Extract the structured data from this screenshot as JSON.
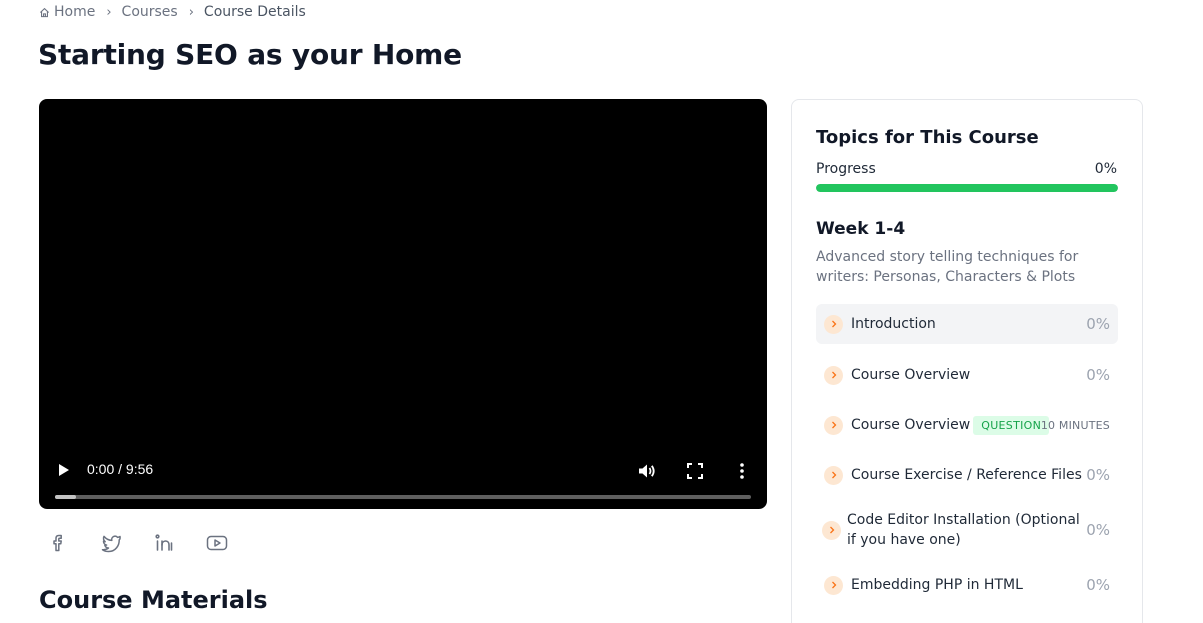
{
  "breadcrumb": {
    "home": "Home",
    "courses": "Courses",
    "current": "Course Details",
    "separator": "›"
  },
  "page": {
    "title": "Starting SEO as your Home"
  },
  "video": {
    "time": "0:00 / 9:56",
    "played_fraction": 0.03
  },
  "social": {
    "icons": [
      "facebook-icon",
      "twitter-icon",
      "linkedin-icon",
      "youtube-icon"
    ]
  },
  "materials": {
    "title": "Course Materials"
  },
  "sidebar": {
    "title": "Topics for This Course",
    "progress_label": "Progress",
    "progress_value": "0%",
    "progress_fraction": 1.0,
    "week": {
      "title": "Week 1-4",
      "description": "Advanced story telling techniques for writers: Personas, Characters & Plots"
    },
    "lessons": [
      {
        "label": "Introduction",
        "pct": "0%"
      },
      {
        "label": "Course Overview",
        "pct": "0%"
      },
      {
        "label": "Course Overview",
        "badge": "QUESTION",
        "duration": "10 MINUTES"
      },
      {
        "label": "Course Exercise / Reference Files",
        "pct": "0%"
      },
      {
        "label": "Code Editor Installation (Optional if you have one)",
        "pct": "0%"
      },
      {
        "label": "Embedding PHP in HTML",
        "pct": "0%"
      }
    ]
  },
  "colors": {
    "progress": "#22c55e",
    "chevron_bg": "#fde7d2",
    "chevron": "#f97316",
    "badge_bg": "#dcfce7",
    "badge_text": "#16a34a"
  }
}
